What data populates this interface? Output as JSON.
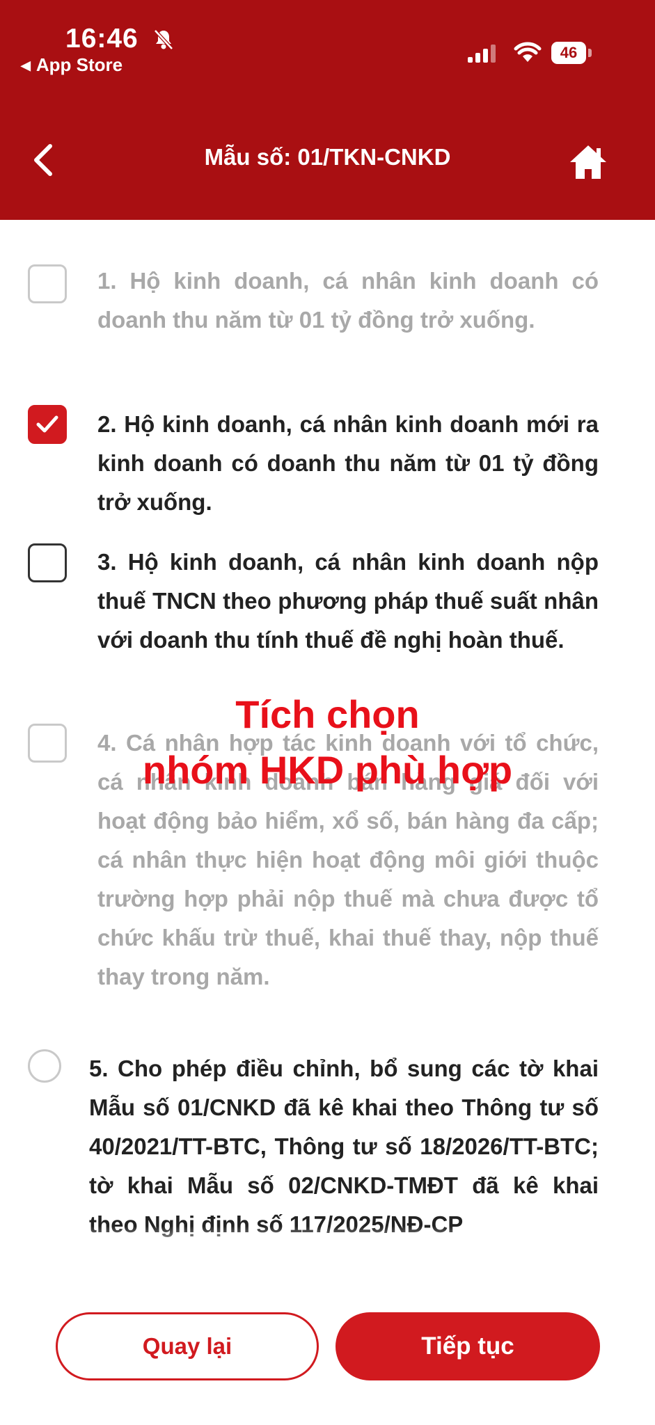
{
  "status_bar": {
    "time": "16:46",
    "back_app": "App Store",
    "battery": "46",
    "icons": [
      "bell-slash-icon",
      "signal-icon",
      "wifi-icon",
      "battery-icon"
    ]
  },
  "header": {
    "title": "Mẫu số: 01/TKN-CNKD",
    "icons": [
      "chevron-left-icon",
      "home-icon"
    ],
    "background": "#a90f12"
  },
  "options": [
    {
      "text": "1. Hộ kinh doanh, cá nhân kinh doanh có doanh thu năm từ 01 tỷ đồng trở xuống.",
      "state": "disabled"
    },
    {
      "text": "2. Hộ kinh doanh, cá nhân kinh doanh mới ra kinh doanh có doanh thu năm từ 01 tỷ đồng trở xuống.",
      "state": "checked"
    },
    {
      "text": "3. Hộ kinh doanh, cá nhân kinh doanh nộp thuế TNCN theo phương pháp thuế suất nhân với doanh thu tính thuế đề nghị hoàn thuế.",
      "state": "unchecked"
    },
    {
      "text": "4. Cá nhân hợp tác kinh doanh với tổ chức, cá nhân kinh doanh bán hàng giá đối với hoạt động bảo hiểm, xổ số, bán hàng đa cấp; cá nhân thực hiện hoạt động môi giới thuộc trường hợp phải nộp thuế mà chưa được tổ chức khấu trừ thuế, khai thuế thay, nộp thuế thay trong năm.",
      "state": "disabled"
    },
    {
      "text": "5. Cho phép điều chỉnh, bổ sung các tờ khai Mẫu số 01/CNKD đã kê khai theo Thông tư số 40/2021/TT-BTC, Thông tư số 18/2026/TT-BTC; tờ khai Mẫu số 02/CNKD-TMĐT đã kê khai theo Nghị định số 117/2025/NĐ-CP",
      "state": "radio"
    }
  ],
  "overlay": {
    "line1": "Tích chọn",
    "line2": "nhóm HKD phù hợp",
    "color": "#e8101a"
  },
  "footer": {
    "back_label": "Quay lại",
    "next_label": "Tiếp tục",
    "accent": "#d11a1f"
  }
}
